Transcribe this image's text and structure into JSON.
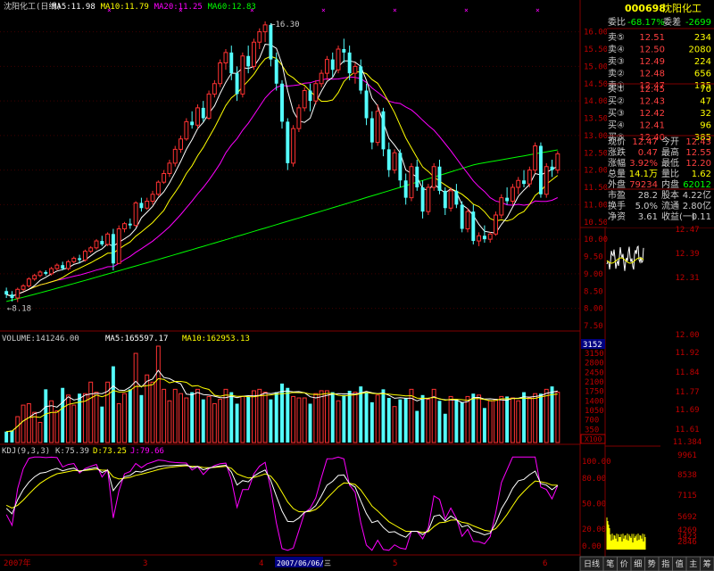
{
  "stock": {
    "code": "000698",
    "name": "沈阳化工"
  },
  "header": {
    "title": "沈阳化工(日线)",
    "ma": [
      {
        "label": "MA5:11.98",
        "color": "#ffffff"
      },
      {
        "label": "MA10:11.79",
        "color": "#ffff00"
      },
      {
        "label": "MA20:11.25",
        "color": "#ff00ff"
      },
      {
        "label": "MA60:12.83",
        "color": "#00ff00"
      }
    ]
  },
  "price_axis": [
    "16.00",
    "15.50",
    "15.00",
    "14.50",
    "14.00",
    "13.50",
    "13.00",
    "12.50",
    "12.00",
    "11.50",
    "11.00",
    "10.50",
    "10.00",
    "9.50",
    "9.00",
    "8.50",
    "8.00",
    "7.50"
  ],
  "annotations": {
    "high": "16.30",
    "low": "8.18"
  },
  "volume_header": {
    "label": "VOLUME:141246.00",
    "ma5": "MA5:165597.17",
    "ma10": "MA10:162953.13"
  },
  "volume_axis": [
    "3150",
    "2800",
    "2450",
    "2100",
    "1750",
    "1400",
    "1050",
    "700",
    "350"
  ],
  "volume_axis_box": "3152",
  "volume_unit": "X100",
  "kdj_header": {
    "label": "KDJ(9,3,3)",
    "k": "K:75.39",
    "d": "D:73.25",
    "j": "J:79.66"
  },
  "kdj_axis": [
    "100.00",
    "80.00",
    "50.00",
    "20.00",
    "0.00"
  ],
  "date_axis": [
    "3",
    "4",
    "5",
    "6",
    "7",
    "8",
    "9"
  ],
  "date_first": "2007年",
  "date_cursor": "2007/06/06/三",
  "order_book": {
    "wei_bi_label": "委比",
    "wei_bi": "-68.17%",
    "wei_cha_label": "委差",
    "wei_cha": "-2699",
    "asks": [
      {
        "label": "卖⑤",
        "price": "12.51",
        "vol": "234"
      },
      {
        "label": "卖④",
        "price": "12.50",
        "vol": "2080"
      },
      {
        "label": "卖③",
        "price": "12.49",
        "vol": "224"
      },
      {
        "label": "卖②",
        "price": "12.48",
        "vol": "656"
      },
      {
        "label": "卖①",
        "price": "12.47",
        "vol": "135"
      }
    ],
    "bids": [
      {
        "label": "买①",
        "price": "12.45",
        "vol": "70"
      },
      {
        "label": "买②",
        "price": "12.43",
        "vol": "47"
      },
      {
        "label": "买③",
        "price": "12.42",
        "vol": "32"
      },
      {
        "label": "买④",
        "price": "12.41",
        "vol": "96"
      },
      {
        "label": "买⑤",
        "price": "12.40",
        "vol": "385"
      }
    ]
  },
  "quote": [
    [
      {
        "l": "现价",
        "v": "12.47",
        "c": "#ff4040"
      },
      {
        "l": "今开",
        "v": "12.43",
        "c": "#ff4040"
      }
    ],
    [
      {
        "l": "涨跌",
        "v": "0.47",
        "c": "#ff4040"
      },
      {
        "l": "最高",
        "v": "12.55",
        "c": "#ff4040"
      }
    ],
    [
      {
        "l": "涨幅",
        "v": "3.92%",
        "c": "#ff4040"
      },
      {
        "l": "最低",
        "v": "12.20",
        "c": "#ff4040"
      }
    ],
    [
      {
        "l": "总量",
        "v": "14.1万",
        "c": "#ffff00"
      },
      {
        "l": "量比",
        "v": "1.62",
        "c": "#ffff00"
      }
    ],
    [
      {
        "l": "外盘",
        "v": "79234",
        "c": "#ff4040"
      },
      {
        "l": "内盘",
        "v": "62012",
        "c": "#00ff00"
      }
    ]
  ],
  "fundamentals": [
    [
      {
        "l": "市盈",
        "v": "28.2"
      },
      {
        "l": "股本",
        "v": "4.22亿"
      }
    ],
    [
      {
        "l": "换手",
        "v": "5.0%"
      },
      {
        "l": "流通",
        "v": "2.80亿"
      }
    ],
    [
      {
        "l": "净资",
        "v": "3.61"
      },
      {
        "l": "收益(一)",
        "v": "0.11"
      }
    ]
  ],
  "intraday_price_axis": [
    "12.47",
    "12.39",
    "12.31",
    "12.00",
    "11.92",
    "11.84",
    "11.77",
    "11.69",
    "11.61",
    "11.384"
  ],
  "intraday_vol_axis": [
    "9961",
    "8538",
    "7115",
    "5692",
    "4269",
    "2846",
    "1423"
  ],
  "bottom_tabs": [
    "日线",
    "笔",
    "价",
    "细",
    "势",
    "指",
    "值",
    "主",
    "筹"
  ],
  "colors": {
    "up": "#ff3232",
    "down": "#54ffff",
    "ma5": "#ffffff",
    "ma10": "#ffff00",
    "ma20": "#ff00ff",
    "ma60": "#00ff00",
    "grid": "#800000"
  },
  "chart_data": {
    "type": "candlestick",
    "title": "沈阳化工(日线)",
    "ylim": [
      7.5,
      16.3
    ],
    "candles": [
      [
        8.5,
        8.6,
        8.3,
        8.4
      ],
      [
        8.4,
        8.5,
        8.2,
        8.3
      ],
      [
        8.3,
        8.6,
        8.18,
        8.55
      ],
      [
        8.55,
        8.7,
        8.5,
        8.65
      ],
      [
        8.65,
        8.9,
        8.6,
        8.85
      ],
      [
        8.85,
        9.0,
        8.8,
        8.95
      ],
      [
        8.95,
        9.1,
        8.9,
        9.05
      ],
      [
        9.05,
        9.1,
        8.95,
        9.0
      ],
      [
        9.0,
        9.2,
        8.95,
        9.15
      ],
      [
        9.15,
        9.3,
        9.1,
        9.25
      ],
      [
        9.25,
        9.35,
        9.1,
        9.15
      ],
      [
        9.15,
        9.4,
        9.1,
        9.35
      ],
      [
        9.35,
        9.5,
        9.3,
        9.45
      ],
      [
        9.45,
        9.55,
        9.3,
        9.4
      ],
      [
        9.4,
        9.7,
        9.35,
        9.65
      ],
      [
        9.65,
        9.8,
        9.6,
        9.75
      ],
      [
        9.75,
        10.0,
        9.7,
        9.95
      ],
      [
        9.95,
        10.1,
        9.8,
        9.85
      ],
      [
        9.85,
        10.2,
        9.8,
        10.15
      ],
      [
        10.15,
        10.3,
        9.1,
        9.3
      ],
      [
        9.3,
        10.4,
        9.3,
        10.3
      ],
      [
        10.3,
        10.5,
        10.2,
        10.45
      ],
      [
        10.45,
        10.6,
        10.3,
        10.4
      ],
      [
        10.4,
        11.1,
        10.35,
        11.05
      ],
      [
        11.05,
        11.2,
        10.8,
        10.9
      ],
      [
        10.9,
        11.2,
        10.85,
        11.1
      ],
      [
        11.1,
        11.4,
        11.0,
        11.3
      ],
      [
        11.3,
        11.7,
        11.25,
        11.65
      ],
      [
        11.65,
        12.0,
        11.6,
        11.9
      ],
      [
        11.9,
        12.3,
        11.8,
        12.2
      ],
      [
        12.2,
        12.7,
        12.1,
        12.6
      ],
      [
        12.6,
        13.0,
        12.5,
        12.9
      ],
      [
        12.9,
        13.5,
        12.85,
        13.4
      ],
      [
        13.4,
        13.7,
        13.2,
        13.3
      ],
      [
        13.3,
        13.9,
        13.2,
        13.8
      ],
      [
        13.8,
        14.0,
        13.4,
        13.5
      ],
      [
        13.5,
        14.3,
        13.45,
        14.2
      ],
      [
        14.2,
        14.6,
        14.1,
        14.5
      ],
      [
        14.5,
        15.2,
        14.4,
        15.1
      ],
      [
        15.1,
        15.5,
        14.9,
        15.4
      ],
      [
        15.4,
        15.6,
        14.6,
        14.8
      ],
      [
        14.8,
        15.0,
        14.0,
        14.2
      ],
      [
        14.2,
        15.4,
        14.1,
        15.3
      ],
      [
        15.3,
        15.6,
        14.8,
        15.0
      ],
      [
        15.0,
        15.8,
        14.9,
        15.7
      ],
      [
        15.7,
        16.1,
        15.5,
        16.0
      ],
      [
        16.0,
        16.3,
        15.7,
        16.2
      ],
      [
        16.2,
        16.25,
        15.0,
        15.2
      ],
      [
        15.2,
        15.4,
        14.3,
        14.5
      ],
      [
        14.5,
        14.6,
        13.2,
        13.4
      ],
      [
        13.4,
        13.5,
        12.0,
        12.2
      ],
      [
        12.2,
        13.3,
        12.1,
        13.2
      ],
      [
        13.2,
        13.9,
        13.1,
        13.8
      ],
      [
        13.8,
        14.4,
        13.7,
        14.3
      ],
      [
        14.3,
        14.5,
        13.7,
        14.0
      ],
      [
        14.0,
        14.6,
        13.9,
        14.5
      ],
      [
        14.5,
        14.9,
        14.4,
        14.8
      ],
      [
        14.8,
        15.3,
        14.6,
        15.2
      ],
      [
        15.2,
        15.4,
        14.7,
        14.9
      ],
      [
        14.9,
        15.6,
        14.8,
        15.5
      ],
      [
        15.5,
        15.8,
        15.1,
        15.4
      ],
      [
        15.4,
        15.6,
        14.6,
        14.8
      ],
      [
        14.8,
        15.1,
        14.5,
        15.0
      ],
      [
        15.0,
        15.2,
        14.2,
        14.3
      ],
      [
        14.3,
        14.5,
        13.3,
        13.5
      ],
      [
        13.5,
        13.7,
        12.6,
        12.8
      ],
      [
        12.8,
        13.9,
        12.7,
        13.7
      ],
      [
        13.7,
        13.8,
        12.4,
        12.6
      ],
      [
        12.6,
        12.8,
        11.8,
        12.0
      ],
      [
        12.0,
        12.6,
        11.9,
        12.5
      ],
      [
        12.5,
        12.6,
        11.5,
        11.7
      ],
      [
        11.7,
        11.9,
        11.0,
        11.2
      ],
      [
        11.2,
        12.2,
        11.1,
        12.1
      ],
      [
        12.1,
        12.3,
        11.4,
        11.5
      ],
      [
        11.5,
        11.7,
        10.6,
        10.8
      ],
      [
        10.8,
        11.6,
        10.7,
        11.5
      ],
      [
        11.5,
        12.2,
        11.4,
        12.1
      ],
      [
        12.1,
        12.3,
        11.3,
        11.4
      ],
      [
        11.4,
        11.5,
        10.7,
        10.9
      ],
      [
        10.9,
        11.5,
        10.8,
        11.4
      ],
      [
        11.4,
        11.6,
        10.9,
        11.0
      ],
      [
        11.0,
        11.1,
        10.2,
        10.3
      ],
      [
        10.3,
        10.9,
        10.2,
        10.8
      ],
      [
        10.8,
        11.0,
        9.85,
        9.95
      ],
      [
        9.95,
        10.2,
        9.8,
        10.1
      ],
      [
        10.1,
        10.4,
        9.9,
        10.0
      ],
      [
        10.0,
        10.2,
        9.9,
        10.15
      ],
      [
        10.15,
        10.8,
        10.1,
        10.7
      ],
      [
        10.7,
        11.3,
        10.6,
        11.2
      ],
      [
        11.2,
        11.5,
        11.0,
        11.1
      ],
      [
        11.1,
        11.6,
        11.0,
        11.5
      ],
      [
        11.5,
        11.8,
        11.3,
        11.7
      ],
      [
        11.7,
        12.0,
        11.5,
        11.6
      ],
      [
        11.6,
        12.1,
        11.5,
        12.0
      ],
      [
        12.0,
        12.8,
        11.9,
        12.7
      ],
      [
        12.7,
        12.8,
        11.2,
        11.3
      ],
      [
        11.3,
        12.2,
        11.2,
        12.1
      ],
      [
        12.1,
        12.3,
        11.8,
        12.0
      ],
      [
        12.0,
        12.55,
        11.9,
        12.47
      ]
    ],
    "volume": [
      380,
      420,
      900,
      1300,
      1350,
      1050,
      700,
      1850,
      1450,
      1100,
      1900,
      1650,
      1300,
      1700,
      1700,
      2100,
      1750,
      1250,
      2100,
      2650,
      1350,
      1700,
      1850,
      3100,
      1650,
      2350,
      2100,
      3350,
      1850,
      1450,
      1850,
      1700,
      1550,
      1750,
      1850,
      1500,
      1600,
      1350,
      1500,
      1850,
      1750,
      1350,
      1600,
      1600,
      1800,
      1850,
      1750,
      1500,
      1750,
      2050,
      1900,
      1600,
      1550,
      1550,
      1350,
      1700,
      1800,
      1800,
      1750,
      1450,
      1650,
      1800,
      1750,
      1950,
      1750,
      1400,
      1650,
      1850,
      1550,
      1250,
      1500,
      1550,
      1850,
      1100,
      1650,
      1500,
      1850,
      1450,
      1000,
      1600,
      1500,
      1400,
      1600,
      1700,
      1650,
      1200,
      1450,
      1500,
      1600,
      1600,
      1550,
      1450,
      1750,
      1550,
      1700,
      1700,
      1850,
      1950,
      1750
    ]
  }
}
